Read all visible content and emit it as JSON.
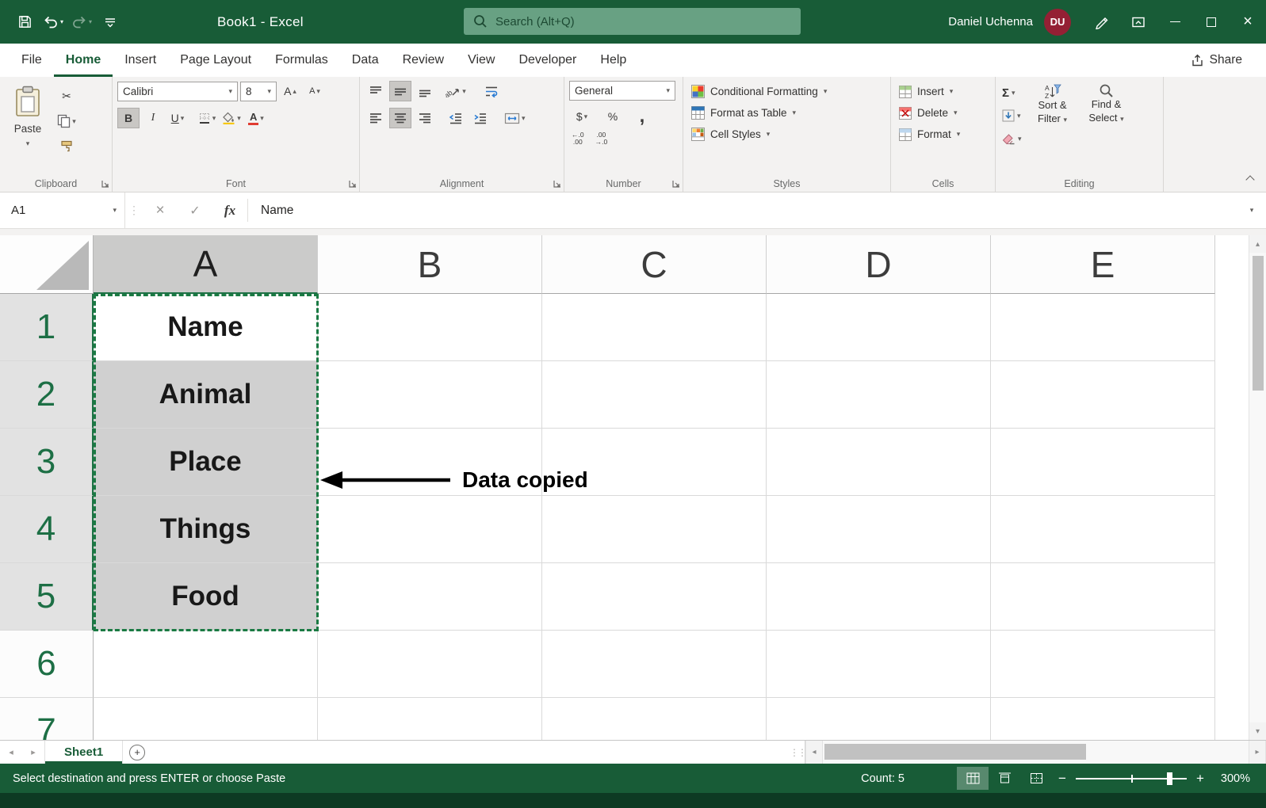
{
  "titlebar": {
    "title": "Book1 - Excel",
    "search_placeholder": "Search (Alt+Q)",
    "user_name": "Daniel Uchenna",
    "user_initials": "DU"
  },
  "menu": {
    "tabs": [
      {
        "label": "File"
      },
      {
        "label": "Home"
      },
      {
        "label": "Insert"
      },
      {
        "label": "Page Layout"
      },
      {
        "label": "Formulas"
      },
      {
        "label": "Data"
      },
      {
        "label": "Review"
      },
      {
        "label": "View"
      },
      {
        "label": "Developer"
      },
      {
        "label": "Help"
      }
    ],
    "share_label": "Share"
  },
  "ribbon": {
    "clipboard": {
      "label": "Clipboard",
      "paste": "Paste"
    },
    "font": {
      "label": "Font",
      "font_name": "Calibri",
      "font_size": "8"
    },
    "alignment": {
      "label": "Alignment"
    },
    "number": {
      "label": "Number",
      "format": "General",
      "currency": "$",
      "percent": "%",
      "comma": ",",
      "inc_top": "←.0",
      "inc_bottom": ".00",
      "dec_top": ".00",
      "dec_bottom": "→.0"
    },
    "styles": {
      "label": "Styles",
      "conditional_formatting": "Conditional Formatting",
      "format_as_table": "Format as Table",
      "cell_styles": "Cell Styles"
    },
    "cells": {
      "label": "Cells",
      "insert": "Insert",
      "delete": "Delete",
      "format": "Format"
    },
    "editing": {
      "label": "Editing",
      "sort_line1": "Sort &",
      "sort_line2": "Filter",
      "find_line1": "Find &",
      "find_line2": "Select"
    }
  },
  "formula_bar": {
    "name_box": "A1",
    "fx": "fx",
    "content": "Name"
  },
  "grid": {
    "columns": [
      "A",
      "B",
      "C",
      "D",
      "E"
    ],
    "rows": [
      "1",
      "2",
      "3",
      "4",
      "5",
      "6",
      "7"
    ],
    "column_a_values": [
      "Name",
      "Animal",
      "Place",
      "Things",
      "Food"
    ]
  },
  "annotation": {
    "label": "Data copied"
  },
  "sheet_bar": {
    "active_tab": "Sheet1"
  },
  "status_bar": {
    "message": "Select destination and press ENTER or choose Paste",
    "count": "Count: 5",
    "zoom_level": "300%"
  },
  "glyphs": {
    "chevron_down": "▾",
    "tri_up": "▴",
    "tri_down": "▾",
    "tri_left": "◂",
    "tri_right": "▸",
    "close": "×",
    "cancel": "×",
    "check": "✓",
    "dots": "⋮",
    "scissors": "✂",
    "sigma": "Σ",
    "plus": "+",
    "minus": "−",
    "letter_a": "A",
    "bold": "B",
    "italic": "I",
    "underline": "U",
    "ab": "ab",
    "sort_a": "A",
    "sort_z": "Z"
  }
}
